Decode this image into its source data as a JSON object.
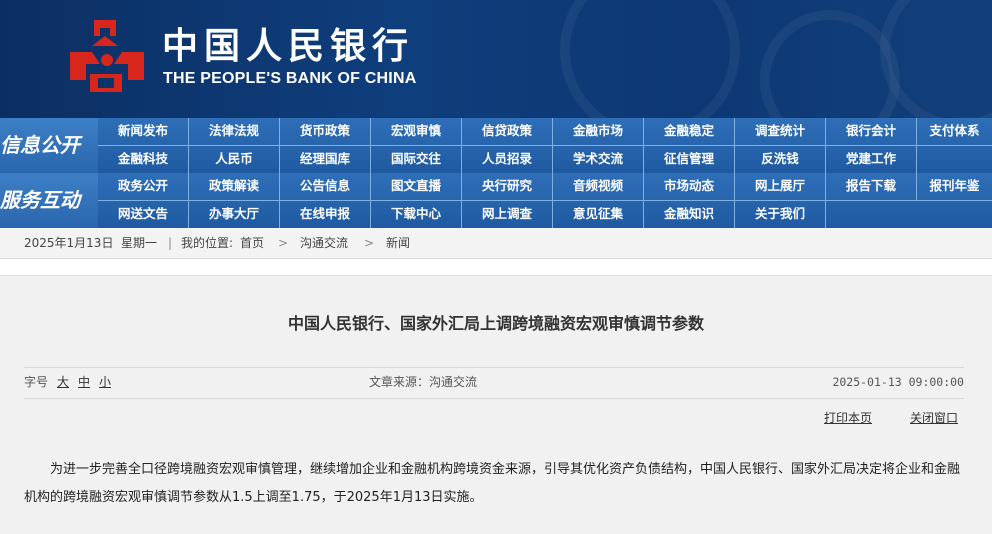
{
  "header": {
    "logo_cn": "中国人民银行",
    "logo_en": "THE PEOPLE'S BANK OF CHINA",
    "brand_red": "#d9261c",
    "banner_blue": "#0f3e7c"
  },
  "nav": {
    "section1": {
      "label": "信息公开",
      "row1": [
        "新闻发布",
        "法律法规",
        "货币政策",
        "宏观审慎",
        "信贷政策",
        "金融市场",
        "金融稳定",
        "调查统计",
        "银行会计",
        "支付体系"
      ],
      "row2": [
        "金融科技",
        "人民币",
        "经理国库",
        "国际交往",
        "人员招录",
        "学术交流",
        "征信管理",
        "反洗钱",
        "党建工作"
      ]
    },
    "section2": {
      "label": "服务互动",
      "row1": [
        "政务公开",
        "政策解读",
        "公告信息",
        "图文直播",
        "央行研究",
        "音频视频",
        "市场动态",
        "网上展厅",
        "报告下载",
        "报刊年鉴"
      ],
      "row2": [
        "网送文告",
        "办事大厅",
        "在线申报",
        "下载中心",
        "网上调查",
        "意见征集",
        "金融知识",
        "关于我们"
      ]
    }
  },
  "breadcrumb": {
    "date": "2025年1月13日",
    "weekday": "星期一",
    "divider": "|",
    "location_label": "我的位置:",
    "home": "首页",
    "arrow": ">",
    "level1": "沟通交流",
    "level2": "新闻"
  },
  "article": {
    "title": "中国人民银行、国家外汇局上调跨境融资宏观审慎调节参数",
    "font_size_label": "字号",
    "font_large": "大",
    "font_medium": "中",
    "font_small": "小",
    "source": "文章来源：沟通交流",
    "datetime": "2025-01-13 09:00:00",
    "print": "打印本页",
    "close": "关闭窗口",
    "body": "为进一步完善全口径跨境融资宏观审慎管理，继续增加企业和金融机构跨境资金来源，引导其优化资产负债结构，中国人民银行、国家外汇局决定将企业和金融机构的跨境融资宏观审慎调节参数从1.5上调至1.75，于2025年1月13日实施。"
  }
}
